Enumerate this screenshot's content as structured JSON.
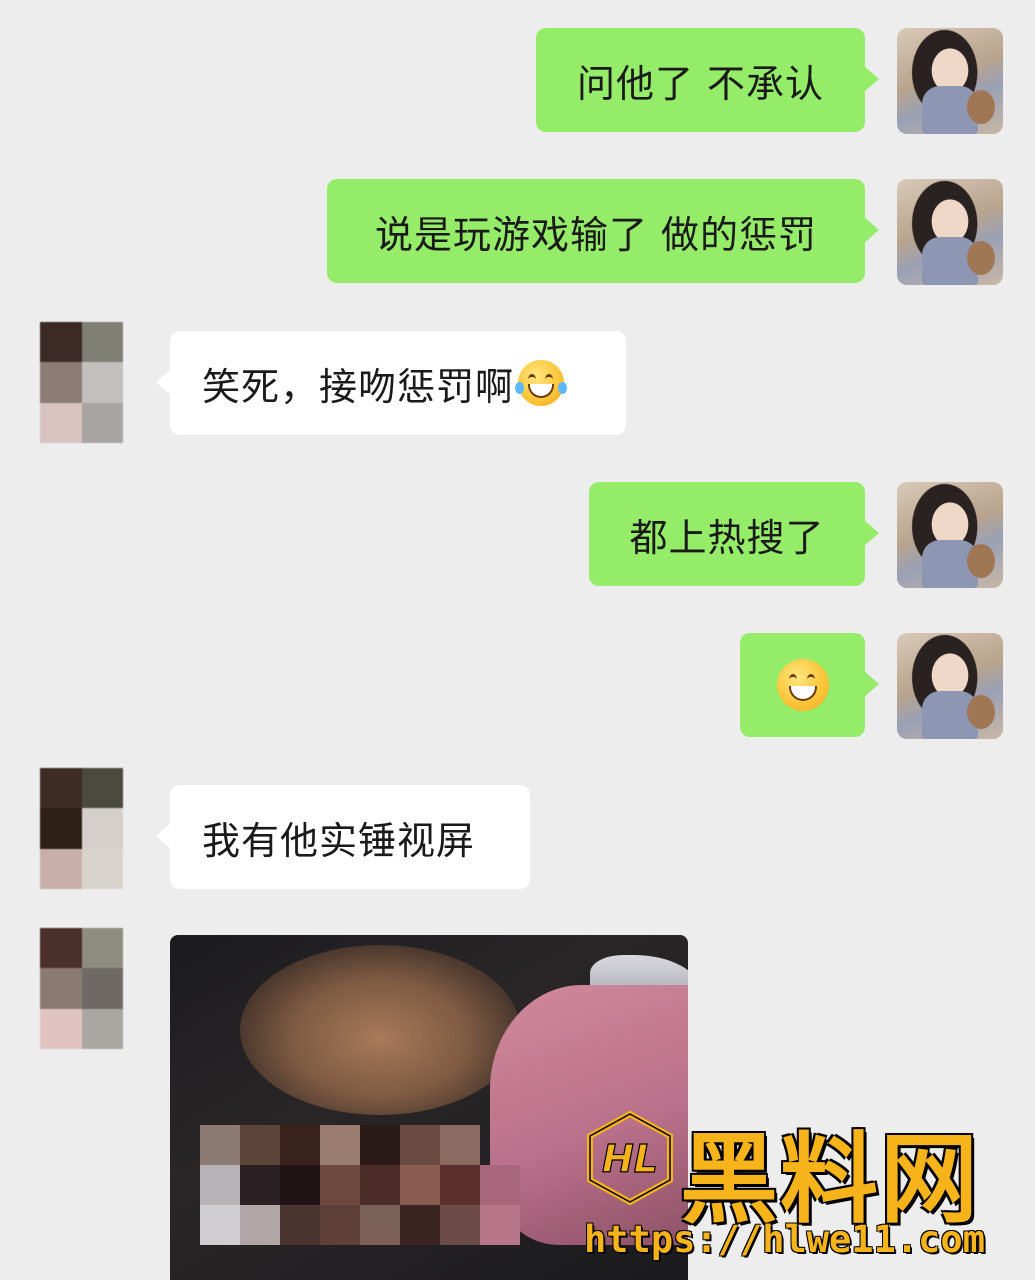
{
  "messages": [
    {
      "side": "me",
      "text": "问他了 不承认"
    },
    {
      "side": "me",
      "text": "说是玩游戏输了 做的惩罚"
    },
    {
      "side": "them",
      "text": "笑死，接吻惩罚啊",
      "emoji": "face-with-tears-of-joy"
    },
    {
      "side": "me",
      "text": "都上热搜了"
    },
    {
      "side": "me",
      "emoji": "grinning-face"
    },
    {
      "side": "them",
      "text": "我有他实锤视屏"
    },
    {
      "side": "them",
      "image": "mosaic-censored-photo"
    }
  ],
  "colors": {
    "background": "#ededed",
    "my_bubble": "#95ec69",
    "their_bubble": "#ffffff",
    "watermark": "#f6b31a"
  },
  "watermark": {
    "title": "黑料网",
    "url": "https://hlwe11.com",
    "logo_text": "HL"
  }
}
